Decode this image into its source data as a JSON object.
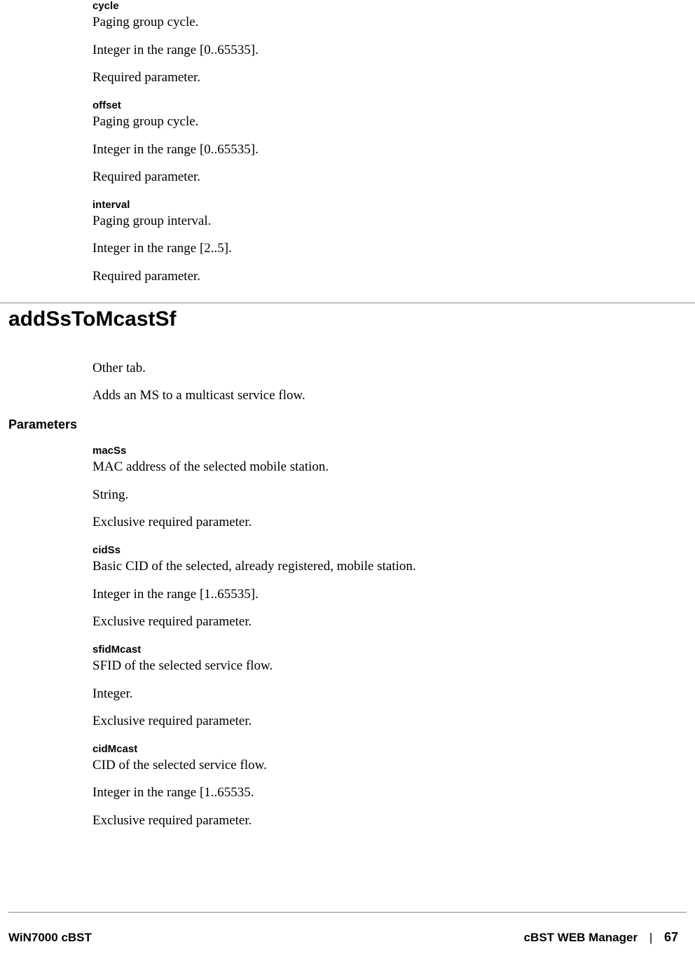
{
  "params_top": [
    {
      "name": "cycle",
      "desc": "Paging group cycle.",
      "type": "Integer in the range [0..65535].",
      "req": "Required parameter."
    },
    {
      "name": "offset",
      "desc": "Paging group cycle.",
      "type": "Integer in the range [0..65535].",
      "req": "Required parameter."
    },
    {
      "name": "interval",
      "desc": "Paging group interval.",
      "type": "Integer in the range [2..5].",
      "req": "Required parameter."
    }
  ],
  "section": {
    "title": "addSsToMcastSf",
    "intro1": "Other tab.",
    "intro2": "Adds an MS to a multicast service flow.",
    "params_heading": "Parameters",
    "params": [
      {
        "name": "macSs",
        "desc": "MAC address of the selected mobile station.",
        "type": "String.",
        "req": "Exclusive required parameter."
      },
      {
        "name": "cidSs",
        "desc": "Basic CID of the selected, already registered, mobile station.",
        "type": "Integer in the range [1..65535].",
        "req": "Exclusive required parameter."
      },
      {
        "name": "sfidMcast",
        "desc": "SFID of the selected service flow.",
        "type": "Integer.",
        "req": "Exclusive required parameter."
      },
      {
        "name": "cidMcast",
        "desc": "CID of the selected service flow.",
        "type": "Integer in the range [1..65535.",
        "req": "Exclusive required parameter."
      }
    ]
  },
  "footer": {
    "left": "WiN7000 cBST",
    "right_title": "cBST WEB Manager",
    "sep": "|",
    "page": "67"
  }
}
